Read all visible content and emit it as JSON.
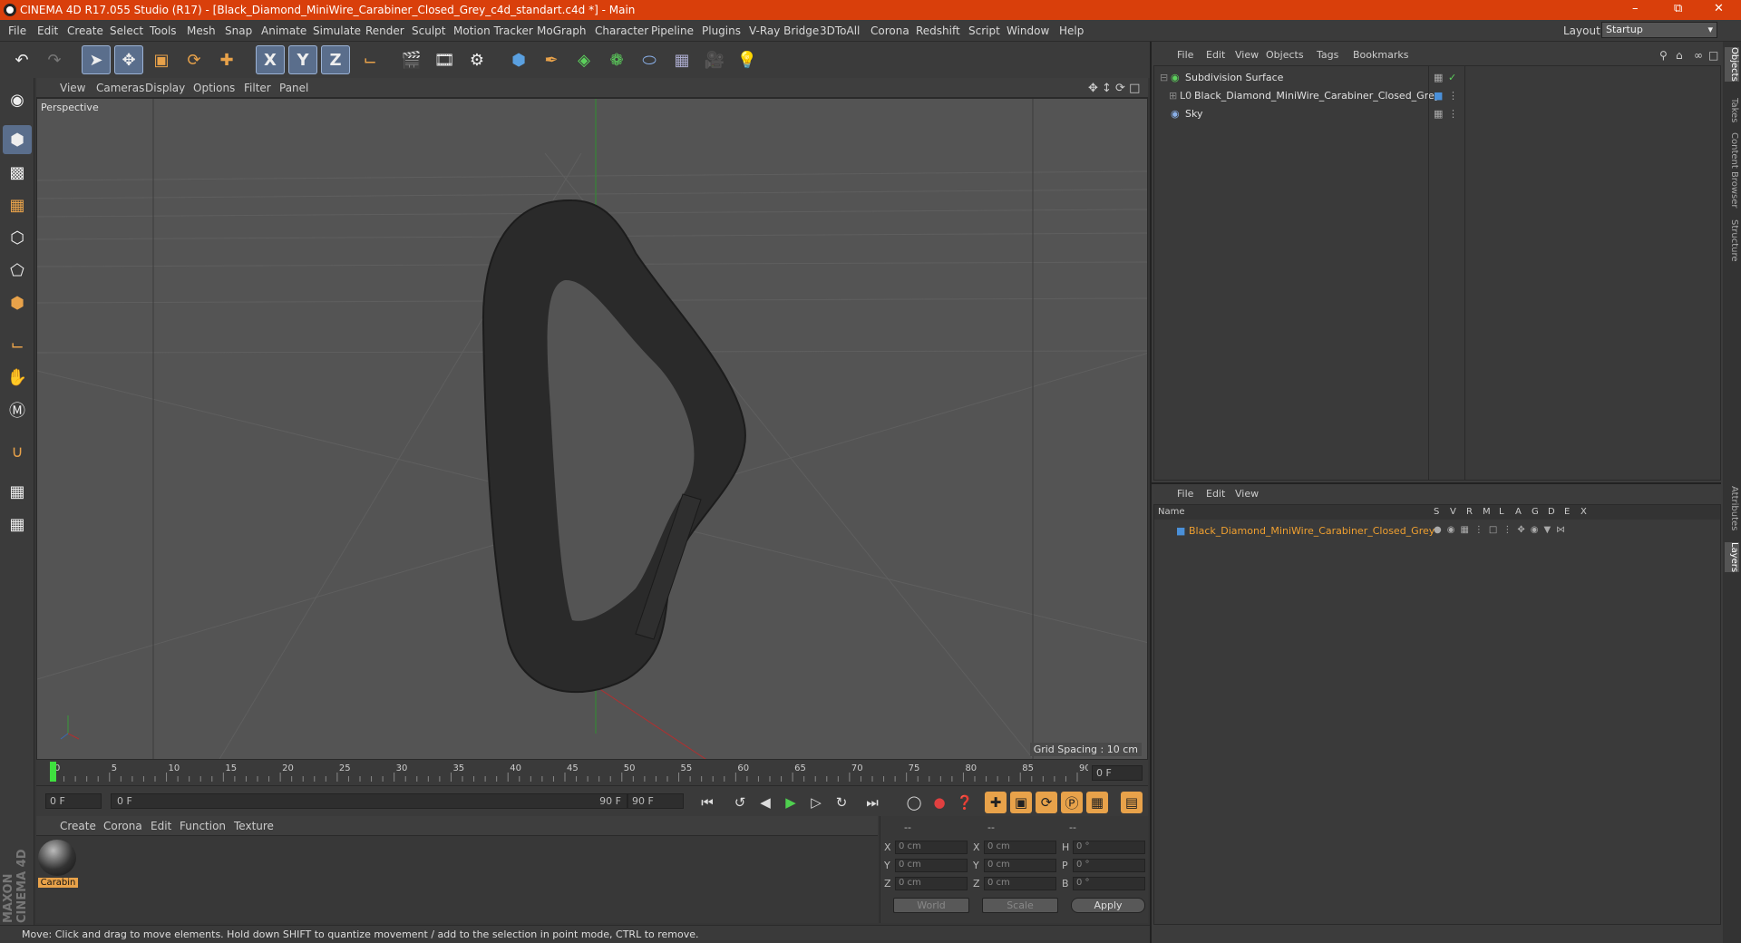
{
  "window": {
    "title": "CINEMA 4D R17.055 Studio (R17) - [Black_Diamond_MiniWire_Carabiner_Closed_Grey_c4d_standart.c4d *] - Main"
  },
  "menubar": {
    "items": [
      "File",
      "Edit",
      "Create",
      "Select",
      "Tools",
      "Mesh",
      "Snap",
      "Animate",
      "Simulate",
      "Render",
      "Sculpt",
      "Motion Tracker",
      "MoGraph",
      "Character",
      "Pipeline",
      "Plugins",
      "V-Ray Bridge",
      "3DToAll",
      "Corona",
      "Redshift",
      "Script",
      "Window",
      "Help"
    ],
    "layout_label": "Layout:",
    "layout_value": "Startup"
  },
  "toolbar": {
    "icons": [
      "undo-icon",
      "redo-icon",
      "select-icon",
      "move-icon",
      "scale-icon",
      "rotate-icon",
      "move-plus-icon",
      "x-axis-icon",
      "y-axis-icon",
      "z-axis-icon",
      "world-coord-icon",
      "render-view-icon",
      "render-picture-queue-icon",
      "render-settings-icon",
      "cube-icon",
      "pen-spline-icon",
      "subdivision-icon",
      "mograph-cloner-icon",
      "deformer-icon",
      "floor-grid-icon",
      "camera-icon",
      "light-icon"
    ],
    "axis_labels": [
      "X",
      "Y",
      "Z"
    ]
  },
  "viewport": {
    "menu": [
      "View",
      "Cameras",
      "Display",
      "Options",
      "Filter",
      "Panel"
    ],
    "label": "Perspective",
    "grid_spacing": "Grid Spacing : 10 cm"
  },
  "timeline": {
    "ticks": [
      "0",
      "5",
      "10",
      "15",
      "20",
      "25",
      "30",
      "35",
      "40",
      "45",
      "50",
      "55",
      "60",
      "65",
      "70",
      "75",
      "80",
      "85",
      "90"
    ],
    "current_frame": "0 F",
    "start_field": "0 F",
    "range_start": "0 F",
    "range_end": "90 F",
    "end_field": "90 F"
  },
  "material_manager": {
    "menu": [
      "Create",
      "Corona",
      "Edit",
      "Function",
      "Texture"
    ],
    "materials": [
      {
        "name": "Carabin"
      }
    ]
  },
  "coordinates": {
    "headers": [
      "--",
      "--",
      "--"
    ],
    "rows": [
      {
        "a": "X",
        "av": "0 cm",
        "b": "X",
        "bv": "0 cm",
        "c": "H",
        "cv": "0 °"
      },
      {
        "a": "Y",
        "av": "0 cm",
        "b": "Y",
        "bv": "0 cm",
        "c": "P",
        "cv": "0 °"
      },
      {
        "a": "Z",
        "av": "0 cm",
        "b": "Z",
        "bv": "0 cm",
        "c": "B",
        "cv": "0 °"
      }
    ],
    "mode1": "World",
    "mode2": "Scale",
    "apply": "Apply"
  },
  "object_manager": {
    "menu": [
      "File",
      "Edit",
      "View",
      "Objects",
      "Tags",
      "Bookmarks"
    ],
    "objects": [
      {
        "name": "Subdivision Surface"
      },
      {
        "name": "Black_Diamond_MiniWire_Carabiner_Closed_Grey"
      },
      {
        "name": "Sky"
      }
    ]
  },
  "layer_manager": {
    "menu": [
      "File",
      "Edit",
      "View"
    ],
    "columns": [
      "Name",
      "S",
      "V",
      "R",
      "M",
      "L",
      "A",
      "G",
      "D",
      "E",
      "X"
    ],
    "layers": [
      {
        "name": "Black_Diamond_MiniWire_Carabiner_Closed_Grey",
        "color": "#4a90d9"
      }
    ]
  },
  "side_tabs": [
    "Objects",
    "Takes",
    "Content Browser",
    "Structure",
    "Attributes",
    "Layers"
  ],
  "status": {
    "text": "Move: Click and drag to move elements. Hold down SHIFT to quantize movement / add to the selection in point mode, CTRL to remove."
  },
  "brand": {
    "text": "MAXON CINEMA 4D"
  },
  "colors": {
    "titlebar": "#d93f0b",
    "accent": "#e8a24a",
    "layer_name": "#f0a030"
  }
}
